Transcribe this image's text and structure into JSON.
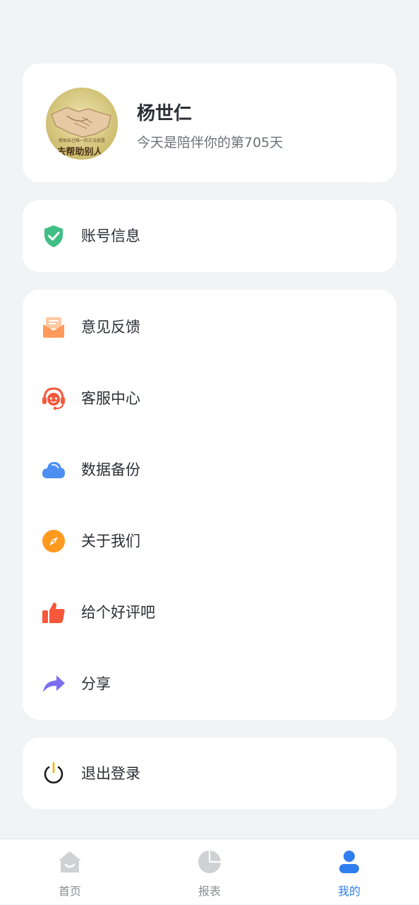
{
  "profile": {
    "name": "杨世仁",
    "subtitle": "今天是陪伴你的第705天",
    "avatar_caption": "去帮助别人"
  },
  "account": {
    "label": "账号信息",
    "icon": "shield-check-icon",
    "color": "#3fbf85"
  },
  "menu": [
    {
      "label": "意见反馈",
      "icon": "feedback-envelope-icon",
      "color": "#ff9a5c"
    },
    {
      "label": "客服中心",
      "icon": "headset-icon",
      "color": "#f5583a"
    },
    {
      "label": "数据备份",
      "icon": "cloud-icon",
      "color": "#4c8ff2"
    },
    {
      "label": "关于我们",
      "icon": "compass-icon",
      "color": "#ff9a1f"
    },
    {
      "label": "给个好评吧",
      "icon": "thumbs-up-icon",
      "color": "#f5583a"
    },
    {
      "label": "分享",
      "icon": "share-arrow-icon",
      "color": "#7b6ff0"
    }
  ],
  "logout": {
    "label": "退出登录",
    "icon": "power-icon",
    "color": "#1a1a1a"
  },
  "tabs": [
    {
      "label": "首页",
      "icon": "home-icon",
      "active": false
    },
    {
      "label": "报表",
      "icon": "pie-chart-icon",
      "active": false
    },
    {
      "label": "我的",
      "icon": "user-icon",
      "active": true
    }
  ],
  "colors": {
    "background": "#f2f3f5",
    "card": "#ffffff",
    "accent": "#2f7ef0",
    "tab_inactive": "#cfd1d4"
  }
}
